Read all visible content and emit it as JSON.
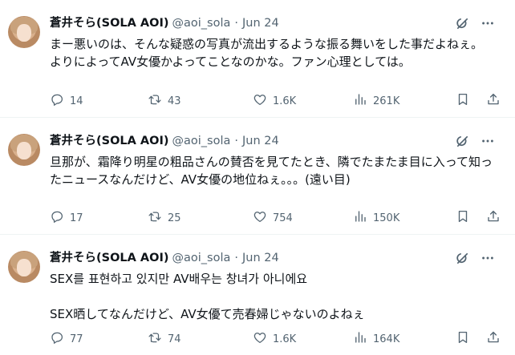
{
  "tweets": [
    {
      "display_name": "蒼井そら(SOLA AOI)",
      "handle": "@aoi_sola",
      "separator": "·",
      "date": "Jun 24",
      "text": "まー悪いのは、そんな疑惑の写真が流出するような振る舞いをした事だよねぇ。\nよりによってAV女優かよってことなのかな。ファン心理としては。",
      "replies": "14",
      "reposts": "43",
      "likes": "1.6K",
      "views": "261K"
    },
    {
      "display_name": "蒼井そら(SOLA AOI)",
      "handle": "@aoi_sola",
      "separator": "·",
      "date": "Jun 24",
      "text": "旦那が、霜降り明星の粗品さんの賛否を見てたとき、隣でたまたま目に入って知ったニュースなんだけど、AV女優の地位ねぇ。。。(遠い目)",
      "replies": "17",
      "reposts": "25",
      "likes": "754",
      "views": "150K"
    },
    {
      "display_name": "蒼井そら(SOLA AOI)",
      "handle": "@aoi_sola",
      "separator": "·",
      "date": "Jun 24",
      "text": "SEX를 표현하고 있지만 AV배우는 창녀가 아니에요\n\nSEX晒してなんだけど、AV女優て売春婦じゃないのよねぇ",
      "replies": "77",
      "reposts": "74",
      "likes": "1.6K",
      "views": "164K"
    }
  ],
  "icons": {
    "grok": "grok-icon",
    "more": "more-icon",
    "reply": "reply-icon",
    "repost": "repost-icon",
    "like": "like-icon",
    "views": "views-icon",
    "bookmark": "bookmark-icon",
    "share": "share-icon"
  },
  "colors": {
    "text": "#0f1419",
    "secondary": "#536471",
    "divider": "#eff3f4",
    "background": "#ffffff"
  }
}
